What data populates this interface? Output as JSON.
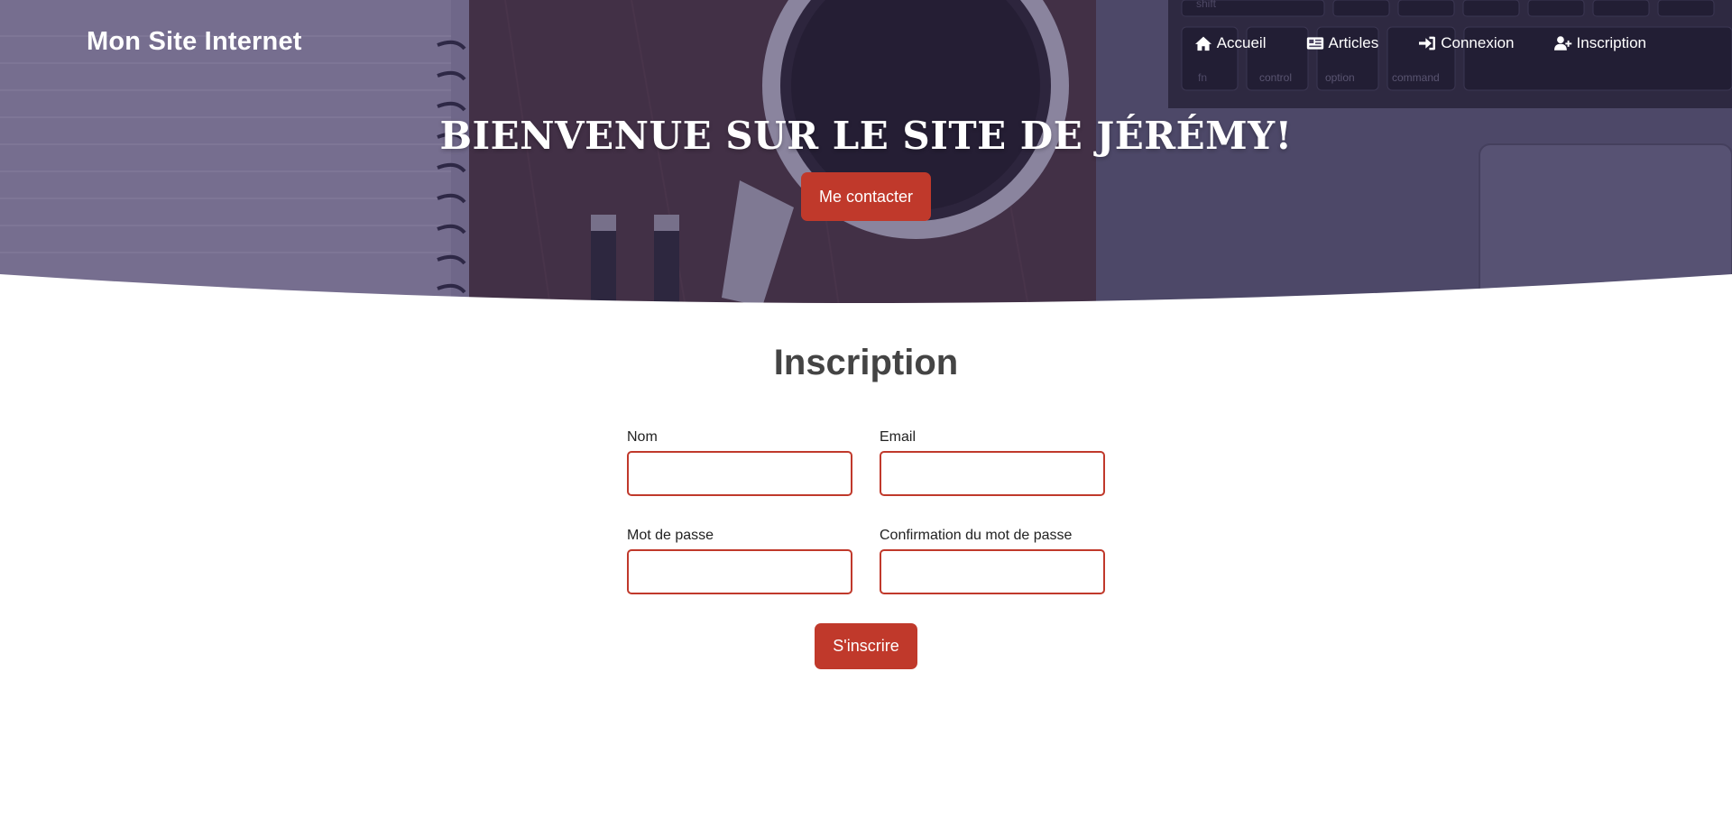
{
  "header": {
    "brand": "Mon Site Internet",
    "nav": [
      {
        "label": "Accueil",
        "icon": "home-icon"
      },
      {
        "label": "Articles",
        "icon": "newspaper-icon"
      },
      {
        "label": "Connexion",
        "icon": "sign-in-icon"
      },
      {
        "label": "Inscription",
        "icon": "user-plus-icon"
      }
    ]
  },
  "hero": {
    "title": "BIENVENUE SUR LE SITE DE JÉRÉMY!",
    "cta_label": "Me contacter",
    "background_description_icons": [
      "notebook",
      "coffee-cup",
      "laptop-keyboard",
      "pens"
    ],
    "keyboard_keys": {
      "shift": "shift",
      "fn": "fn",
      "control": "control",
      "option": "option",
      "command": "command"
    }
  },
  "form": {
    "title": "Inscription",
    "fields": {
      "nom": {
        "label": "Nom",
        "value": ""
      },
      "email": {
        "label": "Email",
        "value": ""
      },
      "mot_de_passe": {
        "label": "Mot de passe",
        "value": ""
      },
      "confirmation": {
        "label": "Confirmation du mot de passe",
        "value": ""
      }
    },
    "submit_label": "S'inscrire"
  },
  "colors": {
    "accent": "#c0392b",
    "hero_tint": "#3b344f",
    "title_text": "#444444"
  }
}
